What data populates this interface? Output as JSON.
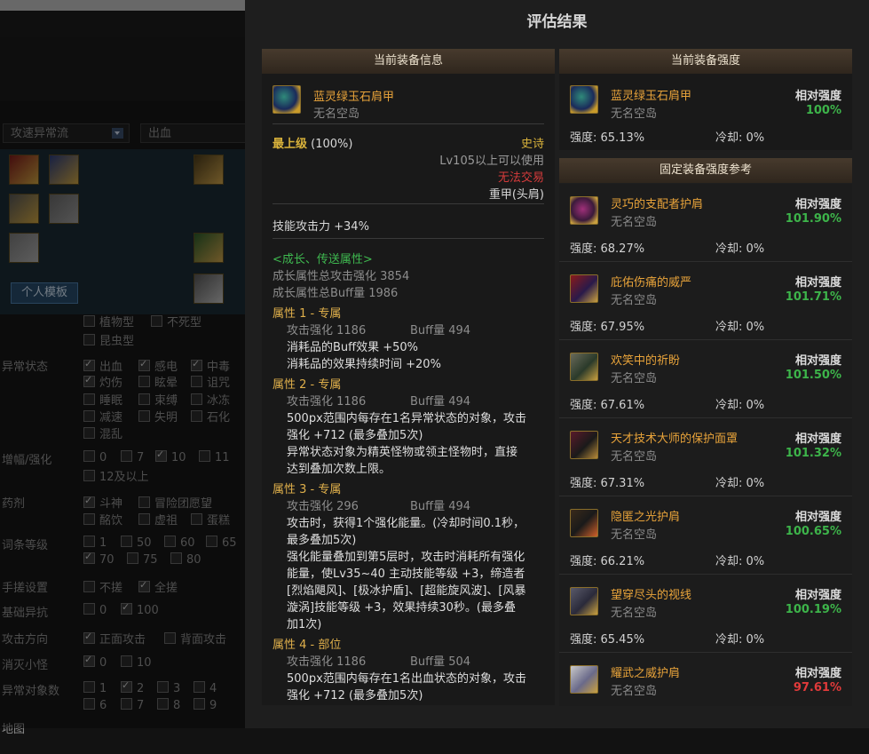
{
  "background": {
    "dropdown1": "攻速异常流",
    "dropdown2": "出血",
    "template_button": "个人模板",
    "species_row": [
      "植物型",
      "不死型",
      "昆虫型"
    ],
    "filters": [
      {
        "label": "异常状态",
        "options": [
          "出血",
          "感电",
          "中毒",
          "灼伤",
          "眩晕",
          "诅咒",
          "睡眠",
          "束缚",
          "冰冻",
          "减速",
          "失明",
          "石化",
          "混乱"
        ]
      },
      {
        "label": "增幅/强化",
        "options": [
          "0",
          "7",
          "10",
          "11",
          "12及以上"
        ]
      },
      {
        "label": "药剂",
        "options": [
          "斗神",
          "冒险团愿望",
          "酩饮",
          "虚祖",
          "蛋糕"
        ]
      },
      {
        "label": "词条等级",
        "options": [
          "1",
          "50",
          "60",
          "65",
          "70",
          "75",
          "80"
        ]
      },
      {
        "label": "手搓设置",
        "options": [
          "不搓",
          "全搓"
        ]
      },
      {
        "label": "基础异抗",
        "options": [
          "0",
          "100"
        ]
      },
      {
        "label": "攻击方向",
        "options": [
          "正面攻击",
          "背面攻击"
        ]
      },
      {
        "label": "消灭小怪",
        "options": [
          "0",
          "10"
        ]
      },
      {
        "label": "异常对象数",
        "options": [
          "1",
          "2",
          "3",
          "4",
          "6",
          "7",
          "8",
          "9"
        ]
      },
      {
        "label": "地图",
        "options": []
      }
    ]
  },
  "modal": {
    "title": "评估结果",
    "current_info": {
      "header": "当前装备信息",
      "name": "蓝灵绿玉石肩甲",
      "server": "无名空岛",
      "grade": "最上级",
      "grade_pct": "(100%)",
      "rarity": "史诗",
      "level_req": "Lv105以上可以使用",
      "trade": "无法交易",
      "slot": "重甲(头肩)",
      "skill_atk": "技能攻击力  +34%",
      "growth_title": "<成长、传送属性>",
      "growth_total": "成长属性总攻击强化 3854",
      "growth_buff": "成长属性总Buff量 1986",
      "attributes": [
        {
          "title": "属性 1 - 专属",
          "atk": "攻击强化  1186",
          "buff": "Buff量  494",
          "desc": [
            "消耗品的Buff效果 +50%",
            "消耗品的效果持续时间 +20%"
          ]
        },
        {
          "title": "属性 2 - 专属",
          "atk": "攻击强化  1186",
          "buff": "Buff量  494",
          "desc": [
            "500px范围内每存在1名异常状态的对象，攻击",
            "强化 +712 (最多叠加5次)",
            "异常状态对象为精英怪物或领主怪物时，直接",
            "达到叠加次数上限。"
          ]
        },
        {
          "title": "属性 3 - 专属",
          "atk": "攻击强化  296",
          "buff": "Buff量  494",
          "desc": [
            "攻击时，获得1个强化能量。(冷却时间0.1秒，",
            "最多叠加5次)",
            "强化能量叠加到第5层时，攻击时消耗所有强化",
            "能量，使Lv35~40 主动技能等级 +3，缔造者",
            "[烈焰飓风]、[极冰护盾]、[超能旋风波]、[风暴",
            "漩涡]技能等级 +3，效果持续30秒。(最多叠",
            "加1次)"
          ]
        },
        {
          "title": "属性 4 - 部位",
          "atk": "攻击强化  1186",
          "buff": "Buff量  504",
          "desc": [
            "500px范围内每存在1名出血状态的对象，攻击",
            "强化 +712 (最多叠加5次)"
          ]
        }
      ]
    },
    "current_strength": {
      "header": "当前装备强度",
      "name": "蓝灵绿玉石肩甲",
      "server": "无名空岛",
      "rel_label": "相对强度",
      "pct": "100%",
      "strength": "强度: 65.13%",
      "cooldown": "冷却: 0%"
    },
    "reference": {
      "header": "固定装备强度参考",
      "items": [
        {
          "name": "灵巧的支配者护肩",
          "server": "无名空岛",
          "rel_label": "相对强度",
          "pct": "101.90%",
          "strength": "强度: 68.27%",
          "cooldown": "冷却: 0%",
          "color": "#3db44a",
          "icon": "shoulder-purple-icon"
        },
        {
          "name": "庇佑伤痛的威严",
          "server": "无名空岛",
          "rel_label": "相对强度",
          "pct": "101.71%",
          "strength": "强度: 67.95%",
          "cooldown": "冷却: 0%",
          "color": "#3db44a",
          "icon": "shoulder-red-icon"
        },
        {
          "name": "欢笑中的祈盼",
          "server": "无名空岛",
          "rel_label": "相对强度",
          "pct": "101.50%",
          "strength": "强度: 67.61%",
          "cooldown": "冷却: 0%",
          "color": "#3db44a",
          "icon": "shoulder-armor-icon"
        },
        {
          "name": "天才技术大师的保护面罩",
          "server": "无名空岛",
          "rel_label": "相对强度",
          "pct": "101.32%",
          "strength": "强度: 67.31%",
          "cooldown": "冷却: 0%",
          "color": "#3db44a",
          "icon": "mask-icon"
        },
        {
          "name": "隐匿之光护肩",
          "server": "无名空岛",
          "rel_label": "相对强度",
          "pct": "100.65%",
          "strength": "强度: 66.21%",
          "cooldown": "冷却: 0%",
          "color": "#3db44a",
          "icon": "shoulder-dark-icon"
        },
        {
          "name": "望穿尽头的视线",
          "server": "无名空岛",
          "rel_label": "相对强度",
          "pct": "100.19%",
          "strength": "强度: 65.45%",
          "cooldown": "冷却: 0%",
          "color": "#3db44a",
          "icon": "shoulder-grey-icon"
        },
        {
          "name": "耀武之威护肩",
          "server": "无名空岛",
          "rel_label": "相对强度",
          "pct": "97.61%",
          "strength": "",
          "cooldown": "",
          "color": "#e03a3a",
          "icon": "shoulder-white-icon"
        }
      ]
    }
  }
}
